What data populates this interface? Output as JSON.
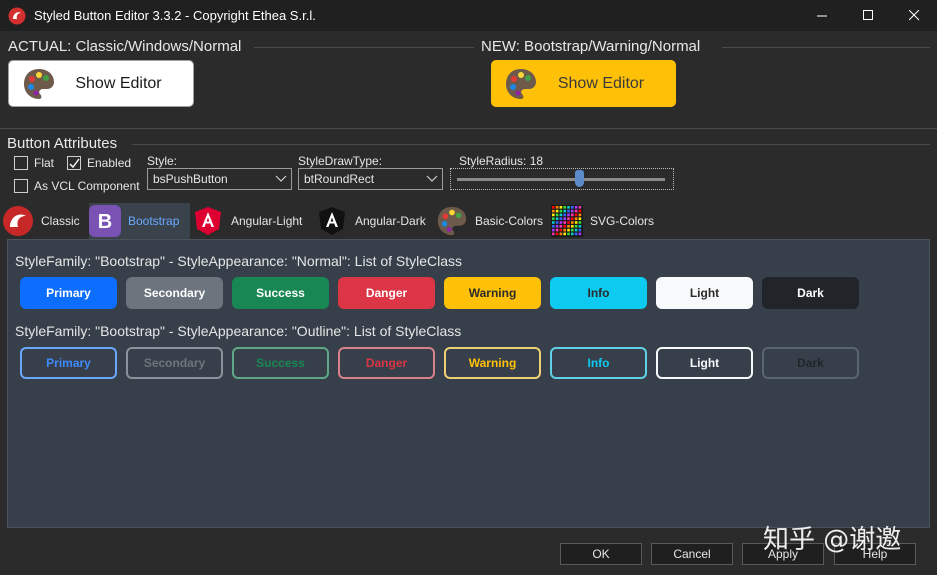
{
  "window": {
    "title": "Styled Button Editor 3.3.2 - Copyright Ethea S.r.l."
  },
  "actual": {
    "heading": "ACTUAL: Classic/Windows/Normal",
    "button_label": "Show Editor"
  },
  "new": {
    "heading": "NEW: Bootstrap/Warning/Normal",
    "button_label": "Show Editor"
  },
  "attributes": {
    "heading": "Button Attributes",
    "flat": {
      "label": "Flat",
      "checked": false
    },
    "enabled": {
      "label": "Enabled",
      "checked": true
    },
    "vcl_component": {
      "label": "As VCL Component",
      "checked": false
    },
    "style": {
      "label": "Style:",
      "value": "bsPushButton"
    },
    "draw_type": {
      "label": "StyleDrawType:",
      "value": "btRoundRect"
    },
    "radius": {
      "label": "StyleRadius: 18",
      "value": 18
    }
  },
  "tabs": [
    {
      "label": "Classic",
      "icon": "classic-logo-icon",
      "active": false
    },
    {
      "label": "Bootstrap",
      "icon": "bootstrap-icon",
      "active": true
    },
    {
      "label": "Angular-Light",
      "icon": "angular-light-icon",
      "active": false
    },
    {
      "label": "Angular-Dark",
      "icon": "angular-dark-icon",
      "active": false
    },
    {
      "label": "Basic-Colors",
      "icon": "palette-icon",
      "active": false
    },
    {
      "label": "SVG-Colors",
      "icon": "color-grid-icon",
      "active": false
    }
  ],
  "bootstrap": {
    "normal_title": "StyleFamily: \"Bootstrap\" - StyleAppearance: \"Normal\": List of StyleClass",
    "outline_title": "StyleFamily: \"Bootstrap\" - StyleAppearance: \"Outline\": List of StyleClass",
    "normal_buttons": [
      {
        "label": "Primary",
        "bg": "#0d6efd",
        "fg": "#ffffff"
      },
      {
        "label": "Secondary",
        "bg": "#6c757d",
        "fg": "#ffffff"
      },
      {
        "label": "Success",
        "bg": "#198754",
        "fg": "#ffffff"
      },
      {
        "label": "Danger",
        "bg": "#dc3545",
        "fg": "#ffffff"
      },
      {
        "label": "Warning",
        "bg": "#ffc107",
        "fg": "#2b2b2b"
      },
      {
        "label": "Info",
        "bg": "#0dcaf0",
        "fg": "#2b2b2b"
      },
      {
        "label": "Light",
        "bg": "#f8f9fa",
        "fg": "#2b2b2b"
      },
      {
        "label": "Dark",
        "bg": "#212529",
        "fg": "#ffffff"
      }
    ],
    "outline_buttons": [
      {
        "label": "Primary",
        "color": "#3d8bfd"
      },
      {
        "label": "Secondary",
        "color": "#6c757d"
      },
      {
        "label": "Success",
        "color": "#198754"
      },
      {
        "label": "Danger",
        "color": "#dc3545"
      },
      {
        "label": "Warning",
        "color": "#ffc107"
      },
      {
        "label": "Info",
        "color": "#0dcaf0"
      },
      {
        "label": "Light",
        "color": "#f8f9fa"
      },
      {
        "label": "Dark",
        "color": "#212529"
      }
    ]
  },
  "dialog": {
    "ok": "OK",
    "cancel": "Cancel",
    "apply": "Apply",
    "help": "Help"
  },
  "watermark": "知乎 @谢邀"
}
